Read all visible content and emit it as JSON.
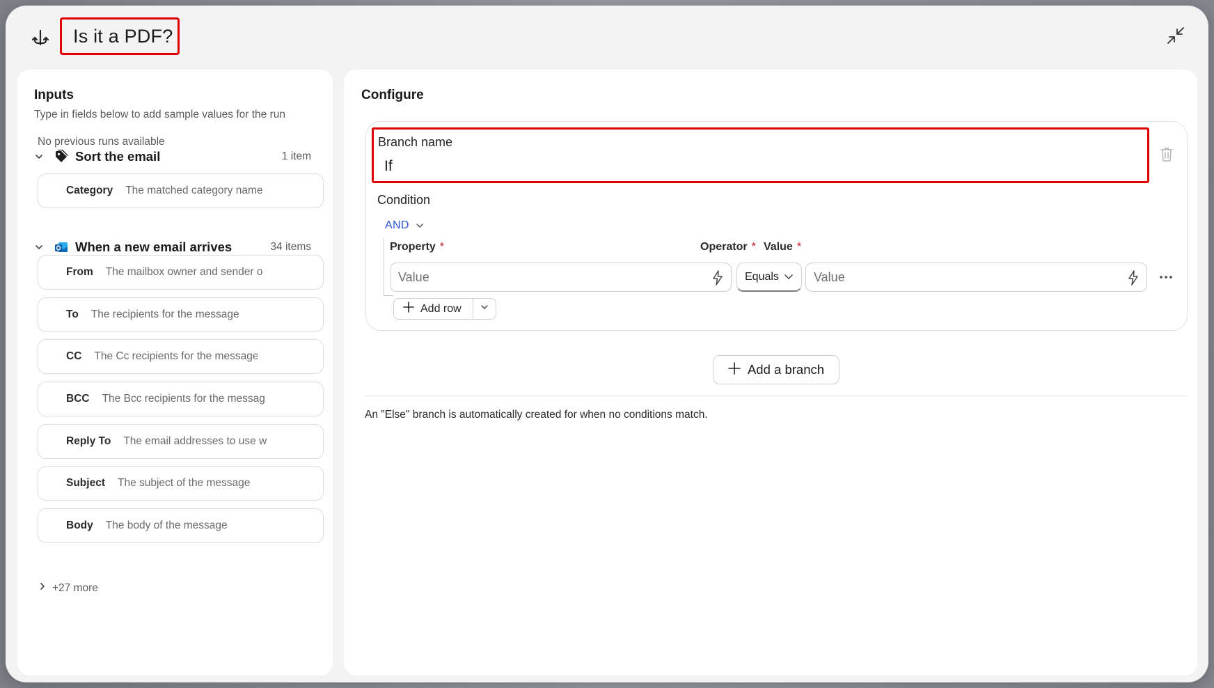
{
  "header": {
    "title": "Is it a PDF?",
    "icon": "condition-branch-icon",
    "collapse_icon": "collapse-icon"
  },
  "inputs_panel": {
    "title": "Inputs",
    "subtitle": "Type in fields below to add sample values for the run",
    "no_runs": "No previous runs available",
    "groups": [
      {
        "name": "Sort the email",
        "count": "1 item",
        "icon": "tag-icon",
        "fields": [
          {
            "label": "Category",
            "placeholder": "The matched category name"
          }
        ]
      },
      {
        "name": "When a new email arrives",
        "count": "34 items",
        "icon": "outlook-mail-icon",
        "fields": [
          {
            "label": "From",
            "placeholder": "The mailbox owner and sender o"
          },
          {
            "label": "To",
            "placeholder": "The recipients for the message"
          },
          {
            "label": "CC",
            "placeholder": "The Cc recipients for the message"
          },
          {
            "label": "BCC",
            "placeholder": "The Bcc recipients for the messag"
          },
          {
            "label": "Reply To",
            "placeholder": "The email addresses to use w"
          },
          {
            "label": "Subject",
            "placeholder": "The subject of the message"
          },
          {
            "label": "Body",
            "placeholder": "The body of the message"
          }
        ]
      }
    ],
    "more_label": "+27 more"
  },
  "configure_panel": {
    "title": "Configure",
    "branch": {
      "name_label": "Branch name",
      "name_value": "If",
      "condition_label": "Condition",
      "logic_operator": "AND",
      "columns": {
        "property": "Property",
        "operator": "Operator",
        "value": "Value",
        "required_mark": "*"
      },
      "row": {
        "property_placeholder": "Value",
        "operator_value": "Equals",
        "value_placeholder": "Value"
      },
      "add_row_label": "Add row"
    },
    "add_branch_label": "Add a branch",
    "else_note": "An \"Else\" branch is automatically created for when no conditions match."
  },
  "colors": {
    "highlight_border": "#e00000",
    "link_blue": "#2b4fd6",
    "required_red": "#c50f1f",
    "outlook_blue": "#0f6cbd"
  }
}
